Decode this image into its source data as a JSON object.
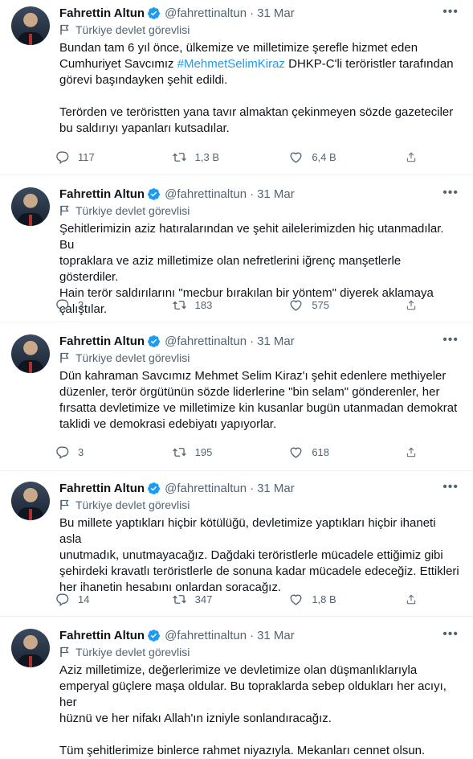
{
  "author": {
    "name": "Fahrettin Altun",
    "handle": "@fahrettinaltun",
    "label": "Türkiye devlet görevlisi"
  },
  "tweets": [
    {
      "date": "31 Mar",
      "text_before": "Bundan tam 6 yıl önce, ülkemize ve milletimize şerefle hizmet eden\nCumhuriyet Savcımız ",
      "hashtag": "#MehmetSelimKiraz",
      "text_after": " DHKP-C'li teröristler tarafından\ngörevi başındayken şehit edildi.\n\nTerörden ve teröristten yana tavır almaktan çekinmeyen sözde gazeteciler\nbu saldırıyı yapanları kutsadılar.",
      "replies": "117",
      "retweets": "1,3 B",
      "likes": "6,4 B"
    },
    {
      "date": "31 Mar",
      "text_before": "Şehitlerimizin aziz hatıralarından ve şehit ailelerimizden hiç utanmadılar. Bu\ntopraklara ve aziz milletimize olan nefretlerini iğrenç manşetlerle gösterdiler.\nHain terör saldırılarını \"mecbur bırakılan bir yöntem\" diyerek aklamaya\nçalıştılar.",
      "hashtag": "",
      "text_after": "",
      "replies": "3",
      "retweets": "183",
      "likes": "575"
    },
    {
      "date": "31 Mar",
      "text_before": "Dün kahraman Savcımız Mehmet Selim Kiraz'ı şehit edenlere methiyeler\ndüzenler, terör örgütünün sözde liderlerine \"bin selam\" gönderenler, her\nfırsatta devletimize ve milletimize kin kusanlar bugün utanmadan demokrat\ntaklidi ve demokrasi edebiyatı yapıyorlar.",
      "hashtag": "",
      "text_after": "",
      "replies": "3",
      "retweets": "195",
      "likes": "618"
    },
    {
      "date": "31 Mar",
      "text_before": "Bu millete yaptıkları hiçbir kötülüğü, devletimize yaptıkları hiçbir ihaneti asla\nunutmadık, unutmayacağız. Dağdaki teröristlerle mücadele ettiğimiz gibi\nşehirdeki kravatlı teröristlerle de sonuna kadar mücadele edeceğiz. Ettikleri\nher ihanetin hesabını onlardan soracağız.",
      "hashtag": "",
      "text_after": "",
      "replies": "14",
      "retweets": "347",
      "likes": "1,8 B"
    },
    {
      "date": "31 Mar",
      "text_before": "Aziz milletimize, değerlerimize ve devletimize olan düşmanlıklarıyla\nemperyal güçlere maşa oldular. Bu topraklarda sebep oldukları her acıyı, her\nhüznü ve her nifakı Allah'ın izniyle sonlandıracağız.\n\nTüm şehitlerimize binlerce rahmet niyazıyla. Mekanları cennet olsun.",
      "hashtag": "",
      "text_after": "",
      "replies": "",
      "retweets": "",
      "likes": ""
    }
  ],
  "colors": {
    "accent": "#1d9bf0",
    "muted": "#536471",
    "text": "#0f1419"
  },
  "icons": [
    "verified-badge-icon",
    "flag-icon",
    "more-icon",
    "reply-icon",
    "retweet-icon",
    "like-icon",
    "share-icon"
  ]
}
